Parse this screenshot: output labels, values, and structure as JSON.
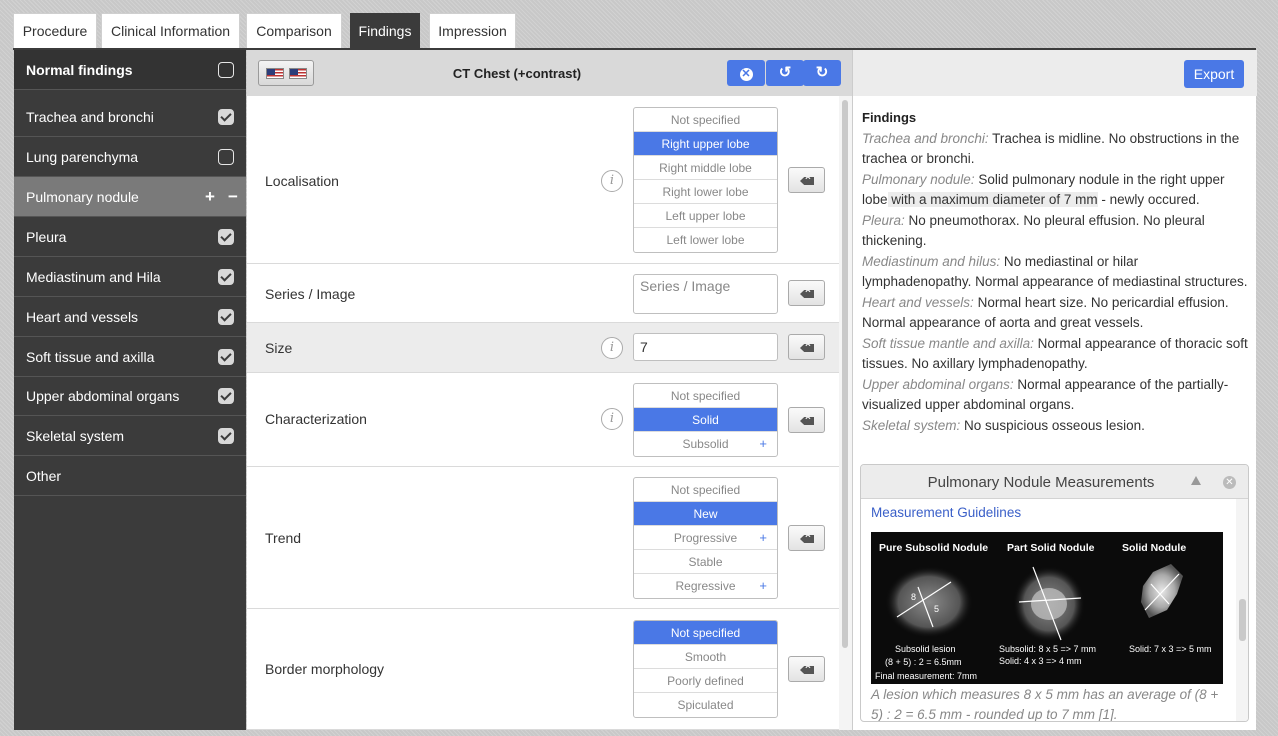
{
  "tabs": [
    "Procedure",
    "Clinical Information",
    "Comparison",
    "Findings",
    "Impression"
  ],
  "active_tab": "Findings",
  "sidebar": {
    "header": "Normal findings",
    "items": [
      {
        "label": "Trachea and bronchi",
        "state": "checked"
      },
      {
        "label": "Lung parenchyma",
        "state": "unchecked"
      },
      {
        "label": "Pulmonary nodule",
        "state": "active"
      },
      {
        "label": "Pleura",
        "state": "checked"
      },
      {
        "label": "Mediastinum and Hila",
        "state": "checked"
      },
      {
        "label": "Heart and vessels",
        "state": "checked"
      },
      {
        "label": "Soft tissue and axilla",
        "state": "checked"
      },
      {
        "label": "Upper abdominal organs",
        "state": "checked"
      },
      {
        "label": "Skeletal system",
        "state": "checked"
      },
      {
        "label": "Other",
        "state": "none"
      }
    ],
    "plus": "+",
    "minus": "−"
  },
  "center": {
    "title": "CT Chest (+contrast)",
    "buttons": [
      "clear",
      "undo",
      "redo"
    ]
  },
  "fields": {
    "localisation": {
      "label": "Localisation",
      "options": [
        "Not specified",
        "Right upper lobe",
        "Right middle lobe",
        "Right lower lobe",
        "Left upper lobe",
        "Left lower lobe"
      ],
      "selected": "Right upper lobe"
    },
    "series": {
      "label": "Series / Image",
      "placeholder": "Series / Image",
      "value": ""
    },
    "size": {
      "label": "Size",
      "value": "7"
    },
    "characterization": {
      "label": "Characterization",
      "options": [
        "Not specified",
        "Solid",
        "Subsolid"
      ],
      "selected": "Solid"
    },
    "trend": {
      "label": "Trend",
      "options": [
        "Not specified",
        "New",
        "Progressive",
        "Stable",
        "Regressive"
      ],
      "selected": "New"
    },
    "border": {
      "label": "Border morphology",
      "options": [
        "Not specified",
        "Smooth",
        "Poorly defined",
        "Spiculated"
      ],
      "selected": "Not specified"
    }
  },
  "right": {
    "export_label": "Export",
    "report_title": "Findings",
    "report": [
      {
        "k": "Trachea and bronchi:",
        "v": " Trachea is midline. No obstructions in the trachea or bronchi."
      },
      {
        "k": "Pulmonary nodule:",
        "v": " Solid pulmonary nodule in the right upper lobe",
        "hl": " with a maximum diameter of 7 mm",
        "v2": " - newly occured."
      },
      {
        "k": "Pleura:",
        "v": " No pneumothorax. No pleural effusion. No pleural thickening."
      },
      {
        "k": "Mediastinum and hilus:",
        "v": " No mediastinal or hilar lymphadenopathy. Normal appearance of mediastinal structures."
      },
      {
        "k": "Heart and vessels:",
        "v": " Normal heart size. No pericardial effusion. Normal appearance of aorta and great vessels."
      },
      {
        "k": "Soft tissue mantle and axilla:",
        "v": " Normal appearance of thoracic soft tissues. No axillary lymphadenopathy."
      },
      {
        "k": "Upper abdominal organs:",
        "v": " Normal appearance of the partially-visualized upper abdominal organs."
      },
      {
        "k": "Skeletal system:",
        "v": " No suspicious osseous lesion."
      }
    ],
    "nodule_box": {
      "title": "Pulmonary Nodule Measurements",
      "link": "Measurement Guidelines",
      "image": {
        "titles": [
          "Pure Subsolid Nodule",
          "Part Solid Nodule",
          "Solid Nodule"
        ],
        "lbl_8": "8",
        "lbl_5": "5",
        "cap1": [
          "Subsolid lesion",
          "(8 + 5) : 2 = 6.5mm",
          "Final measurement: 7mm"
        ],
        "cap2": [
          "Subsolid: 8 x 5 => 7 mm",
          "Solid: 4 x 3 => 4 mm"
        ],
        "cap3": [
          "Solid: 7 x 3 => 5 mm"
        ]
      },
      "caption": "A lesion which measures 8 x 5 mm has an average of (8 + 5) : 2 = 6.5 mm - rounded up to 7 mm [1]."
    }
  }
}
